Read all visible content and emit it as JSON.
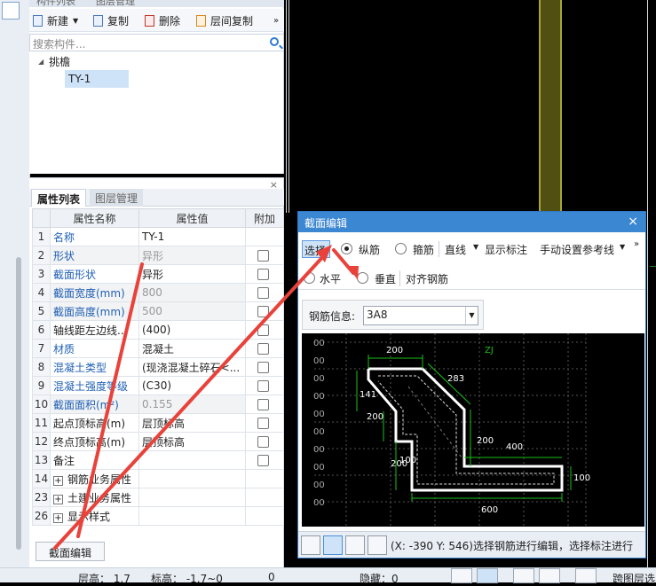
{
  "component_panel": {
    "top_tab_1": "构件列表",
    "top_tab_2": "图层管理",
    "toolbar": {
      "new": "新建",
      "copy": "复制",
      "delete": "删除",
      "floor_copy": "层间复制",
      "more": "»"
    },
    "search_placeholder": "搜索构件...",
    "tree_group": "挑檐",
    "tree_leaf": "TY-1"
  },
  "property_panel": {
    "close": "×",
    "tabs": [
      "属性列表",
      "图层管理"
    ],
    "columns": [
      "",
      "属性名称",
      "属性值",
      "附加"
    ],
    "rows": [
      {
        "no": "1",
        "name": "名称",
        "value": "TY-1"
      },
      {
        "no": "2",
        "name": "形状",
        "value": "异形"
      },
      {
        "no": "3",
        "name": "截面形状",
        "value": "异形"
      },
      {
        "no": "4",
        "name": "截面宽度(mm)",
        "value": "800"
      },
      {
        "no": "5",
        "name": "截面高度(mm)",
        "value": "500"
      },
      {
        "no": "6",
        "name": "轴线距左边线...",
        "value": "(400)"
      },
      {
        "no": "7",
        "name": "材质",
        "value": "混凝土"
      },
      {
        "no": "8",
        "name": "混凝土类型",
        "value": "(现浇混凝土碎石<..."
      },
      {
        "no": "9",
        "name": "混凝土强度等级",
        "value": "(C30)"
      },
      {
        "no": "10",
        "name": "截面面积(m²)",
        "value": "0.155"
      },
      {
        "no": "11",
        "name": "起点顶标高(m)",
        "value": "层顶标高"
      },
      {
        "no": "12",
        "name": "终点顶标高(m)",
        "value": "层顶标高"
      },
      {
        "no": "13",
        "name": "备注",
        "value": ""
      },
      {
        "no": "14",
        "name": "钢筋业务属性",
        "value": ""
      },
      {
        "no": "23",
        "name": "土建业务属性",
        "value": ""
      },
      {
        "no": "26",
        "name": "显示样式",
        "value": ""
      }
    ],
    "edit_button": "截面编辑"
  },
  "dialog": {
    "title": "截面编辑",
    "close": "×",
    "toolbar": {
      "select": "选择",
      "longitudinal": "纵筋",
      "stirrup": "箍筋",
      "line": "直线",
      "show_dim": "显示标注",
      "manual_ref": "手动设置参考线",
      "more": "»"
    },
    "toolbar2": {
      "horizontal": "水平",
      "vertical": "垂直",
      "align": "对齐钢筋"
    },
    "rebar_info_label": "钢筋信息:",
    "rebar_info_value": "3A8",
    "canvas": {
      "corner_label": "ZJ",
      "dims": [
        "200",
        "283",
        "141",
        "200",
        "200",
        "400",
        "200",
        "100",
        "100",
        "600"
      ],
      "axis_ticks": [
        "00",
        "00",
        "00",
        "00",
        "00",
        "00",
        "00",
        "00",
        "00",
        "00"
      ]
    },
    "status_text": "(X: -390 Y: 546)选择钢筋进行编辑，选择标注进行"
  },
  "bottom_bar": {
    "floor_height": "层高： 1.7",
    "elevation": "标高： -1.7~0",
    "zero": "0",
    "hidden": "隐藏：0",
    "cross_floor": "跨图层选"
  }
}
